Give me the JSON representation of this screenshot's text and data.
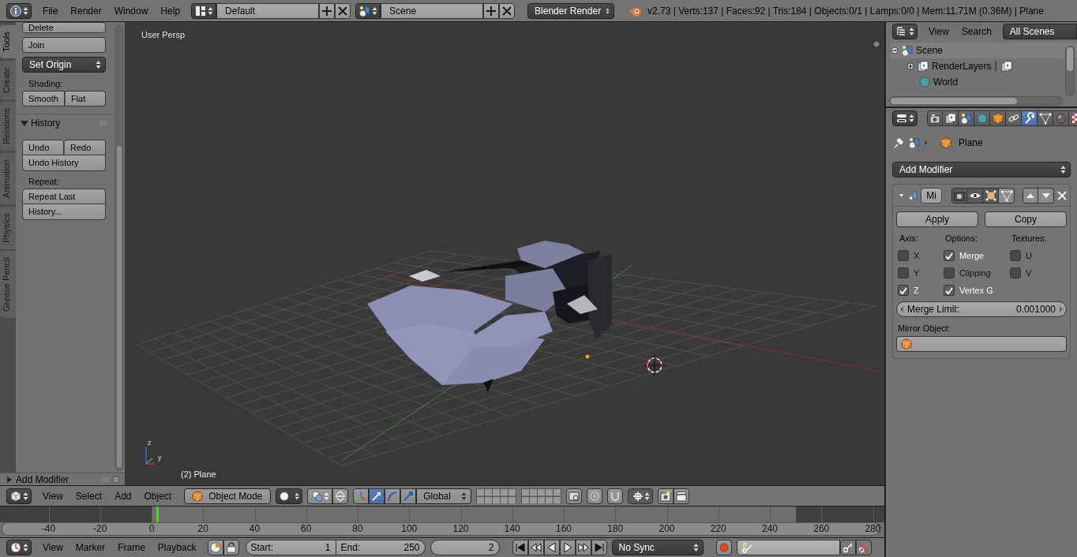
{
  "top_bar": {
    "menus": [
      "File",
      "Render",
      "Window",
      "Help"
    ],
    "layout": "Default",
    "scene": "Scene",
    "engine": "Blender Render",
    "stats": "v2.73 | Verts:137 | Faces:92 | Tris:184 | Objects:0/1 | Lamps:0/0 | Mem:11.71M (0.36M) | Plane"
  },
  "tool_shelf": {
    "tabs": [
      {
        "label": "Tools",
        "selected": true
      },
      {
        "label": "Create",
        "selected": false
      },
      {
        "label": "Relations",
        "selected": false
      },
      {
        "label": "Animation",
        "selected": false
      },
      {
        "label": "Physics",
        "selected": false
      },
      {
        "label": "Grease Pencil",
        "selected": false
      }
    ],
    "items": [
      {
        "kind": "group",
        "rows": [
          [
            "Delete"
          ]
        ]
      },
      {
        "kind": "group",
        "rows": [
          [
            "Join"
          ]
        ]
      },
      {
        "kind": "dropdown",
        "label": "Set Origin"
      },
      {
        "kind": "label",
        "label": "Shading:"
      },
      {
        "kind": "group",
        "rows": [
          [
            "Smooth",
            "Flat"
          ]
        ]
      },
      {
        "kind": "panel",
        "label": "History",
        "expanded": true
      },
      {
        "kind": "group",
        "rows": [
          [
            "Undo",
            "Redo"
          ],
          [
            "Undo History"
          ]
        ]
      },
      {
        "kind": "label",
        "label": "Repeat:"
      },
      {
        "kind": "group",
        "rows": [
          [
            "Repeat Last"
          ],
          [
            "History..."
          ]
        ]
      }
    ],
    "bottom_panel": {
      "label": "Add Modifier",
      "expanded": false
    }
  },
  "viewport": {
    "view_name": "User Persp",
    "object_label": "(2) Plane",
    "axis_labels": [
      "z",
      "y"
    ]
  },
  "view_header": {
    "menus": [
      "View",
      "Select",
      "Add",
      "Object"
    ],
    "mode": "Object Mode",
    "manipulators": [
      {
        "kind": "translate",
        "selected": true
      },
      {
        "kind": "rotate",
        "selected": false
      },
      {
        "kind": "scale",
        "selected": false
      }
    ],
    "orientation": "Global"
  },
  "timeline": {
    "ticks": [
      "-40",
      "-20",
      "0",
      "20",
      "40",
      "60",
      "80",
      "100",
      "120",
      "140",
      "160",
      "180",
      "200",
      "220",
      "240",
      "260",
      "280"
    ]
  },
  "timeline_header": {
    "menus": [
      "View",
      "Marker",
      "Frame",
      "Playback"
    ],
    "start": {
      "label": "Start:",
      "value": "1"
    },
    "end": {
      "label": "End:",
      "value": "250"
    },
    "current_frame": "2",
    "sync": "No Sync"
  },
  "outliner": {
    "menus": [
      "View",
      "Search"
    ],
    "filter": "All Scenes",
    "tree": [
      {
        "label": "Scene",
        "kind": "scene",
        "expanded": true,
        "children": [
          {
            "label": "RenderLayers",
            "kind": "layers",
            "expanded": false
          },
          {
            "label": "World",
            "kind": "world"
          }
        ]
      }
    ]
  },
  "properties": {
    "context_tabs": [
      {
        "kind": "render",
        "selected": false
      },
      {
        "kind": "layers",
        "selected": false
      },
      {
        "kind": "scene",
        "selected": false
      },
      {
        "kind": "world",
        "selected": false
      },
      {
        "kind": "object",
        "selected": false
      },
      {
        "kind": "constraints",
        "selected": false
      },
      {
        "kind": "modifiers",
        "selected": true
      },
      {
        "kind": "data",
        "selected": false
      },
      {
        "kind": "material",
        "selected": false
      },
      {
        "kind": "texture",
        "selected": false
      }
    ],
    "breadcrumb": "Plane",
    "add_modifier": "Add Modifier",
    "modifier": {
      "expanded": true,
      "name": "Mi",
      "toggles": [
        {
          "kind": "render",
          "on": true
        },
        {
          "kind": "view",
          "on": true
        },
        {
          "kind": "editmode",
          "on": true
        },
        {
          "kind": "cage",
          "on": false
        }
      ],
      "buttons": [
        "Apply",
        "Copy"
      ],
      "columns": [
        {
          "title": "Axis:",
          "options": [
            {
              "label": "X",
              "checked": false
            },
            {
              "label": "Y",
              "checked": false
            },
            {
              "label": "Z",
              "checked": true
            }
          ]
        },
        {
          "title": "Options:",
          "options": [
            {
              "label": "Merge",
              "checked": true
            },
            {
              "label": "Clipping",
              "checked": false
            },
            {
              "label": "Vertex G",
              "checked": true
            }
          ]
        },
        {
          "title": "Textures:",
          "options": [
            {
              "label": "U",
              "checked": false
            },
            {
              "label": "V",
              "checked": false
            }
          ]
        }
      ],
      "merge_limit": {
        "label": "Merge Limit:",
        "value": "0.001000"
      },
      "mirror_object": {
        "label": "Mirror Object:"
      }
    }
  }
}
